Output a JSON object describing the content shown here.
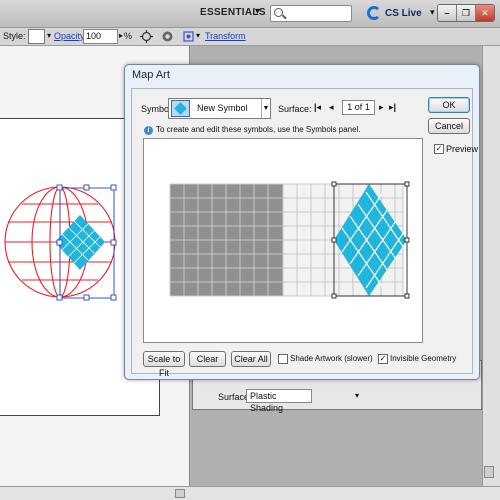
{
  "app": {
    "workspace": "ESSENTIALS",
    "search_value": "",
    "cs_live": "CS Live"
  },
  "control_bar": {
    "style_label": "Style:",
    "opacity_label": "Opacity:",
    "opacity_value": "100",
    "opacity_unit": "%",
    "transform_label": "Transform"
  },
  "underlying_dialog": {
    "surface_label": "Surface:",
    "surface_value": "Plastic Shading"
  },
  "dialog": {
    "title": "Map Art",
    "symbol_label": "Symbol:",
    "symbol_value": "New Symbol",
    "surface_label": "Surface:",
    "surface_count": "1 of 1",
    "info_text": "To create and edit these symbols, use the Symbols panel.",
    "ok_label": "OK",
    "cancel_label": "Cancel",
    "preview_label": "Preview",
    "preview_checked": true,
    "buttons": {
      "scale_to_fit": "Scale to Fit",
      "clear": "Clear",
      "clear_all": "Clear All"
    },
    "shade_artwork_label": "Shade Artwork (slower)",
    "shade_artwork_checked": false,
    "invisible_geometry_label": "Invisible Geometry",
    "invisible_geometry_checked": true,
    "colors": {
      "symbol_fill": "#20b5dd",
      "shaded_area": "#909090",
      "selection": "#1f44d8",
      "globe_lines": "#e8202a"
    }
  }
}
